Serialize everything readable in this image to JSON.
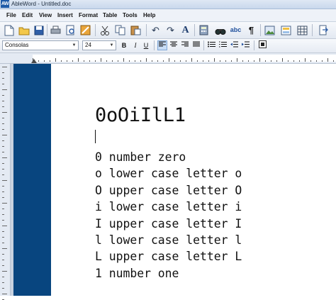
{
  "app": {
    "badge": "AW",
    "window_title": "AbleWord - Untitled.doc"
  },
  "menu": [
    "File",
    "Edit",
    "View",
    "Insert",
    "Format",
    "Table",
    "Tools",
    "Help"
  ],
  "toolbar": {
    "icons": [
      "new-document-icon",
      "open-folder-icon",
      "save-icon",
      "print-icon",
      "print-preview-icon",
      "pdf-export-icon",
      "cut-icon",
      "copy-icon",
      "paste-icon",
      "undo-icon",
      "redo-icon",
      "font-icon",
      "calculator-icon",
      "find-icon",
      "spellcheck-icon",
      "paragraph-mark-icon",
      "insert-image-icon",
      "page-layout-icon",
      "insert-table-icon",
      "exit-icon"
    ],
    "spellcheck_label": "abc"
  },
  "format": {
    "font_name": "Consolas",
    "font_size": "24",
    "bold": "B",
    "italic": "I",
    "underline": "U"
  },
  "document": {
    "heading": "0oOiIlL1",
    "lines": [
      "0 number zero",
      "o lower case letter o",
      "O upper case letter O",
      "i lower case letter i",
      "I upper case letter I",
      "l lower case letter l",
      "L upper case letter L",
      "1 number one"
    ]
  },
  "colors": {
    "left_band": "#08457f",
    "page_background": "#ffffff"
  }
}
